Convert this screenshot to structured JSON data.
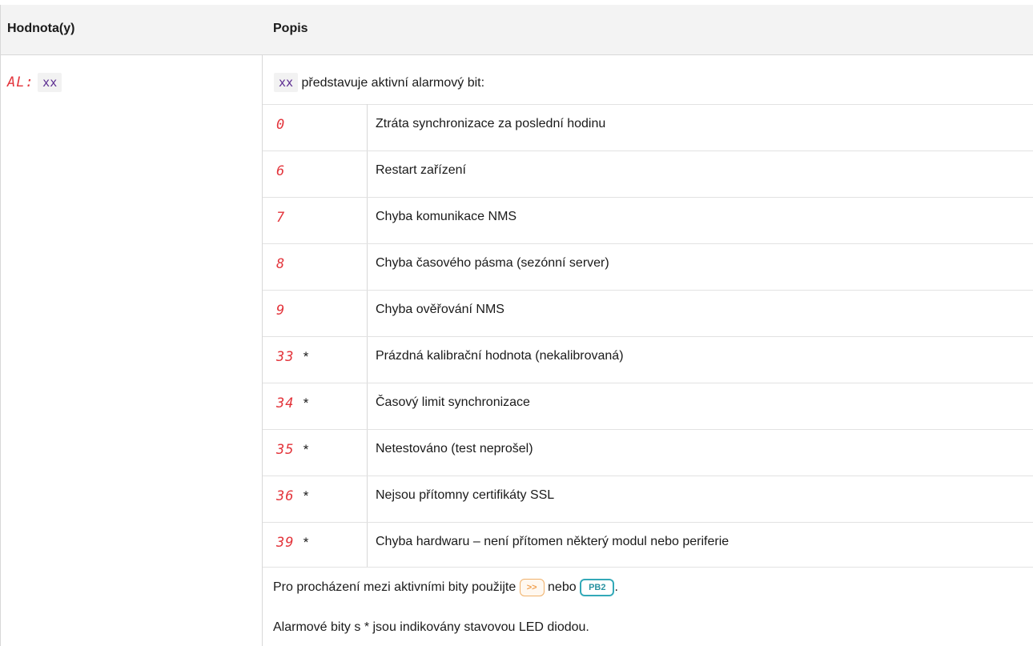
{
  "header": {
    "col1": "Hodnota(y)",
    "col2": "Popis"
  },
  "value": {
    "display": "AL:",
    "code": "xx"
  },
  "intro": {
    "code": "xx",
    "text": "představuje aktivní alarmový bit:"
  },
  "rows": [
    {
      "code": "0",
      "star": "",
      "desc": "Ztráta synchronizace za poslední hodinu"
    },
    {
      "code": "6",
      "star": "",
      "desc": "Restart zařízení"
    },
    {
      "code": "7",
      "star": "",
      "desc": "Chyba komunikace NMS"
    },
    {
      "code": "8",
      "star": "",
      "desc": "Chyba časového pásma (sezónní server)"
    },
    {
      "code": "9",
      "star": "",
      "desc": "Chyba ověřování NMS"
    },
    {
      "code": "33",
      "star": "*",
      "desc": "Prázdná kalibrační hodnota (nekalibrovaná)"
    },
    {
      "code": "34",
      "star": "*",
      "desc": "Časový limit synchronizace"
    },
    {
      "code": "35",
      "star": "*",
      "desc": "Netestováno (test neprošel)"
    },
    {
      "code": "36",
      "star": "*",
      "desc": "Nejsou přítomny certifikáty SSL"
    },
    {
      "code": "39",
      "star": "*",
      "desc": "Chyba hardwaru – není přítomen některý modul nebo periferie"
    }
  ],
  "footer": {
    "text_before": "Pro procházení mezi aktivními bity použijte",
    "button_arrow": ">>",
    "text_between": "nebo",
    "button_pb2": "PB2",
    "text_after": ".",
    "note": "Alarmové bity s * jsou indikovány stavovou LED diodou."
  }
}
